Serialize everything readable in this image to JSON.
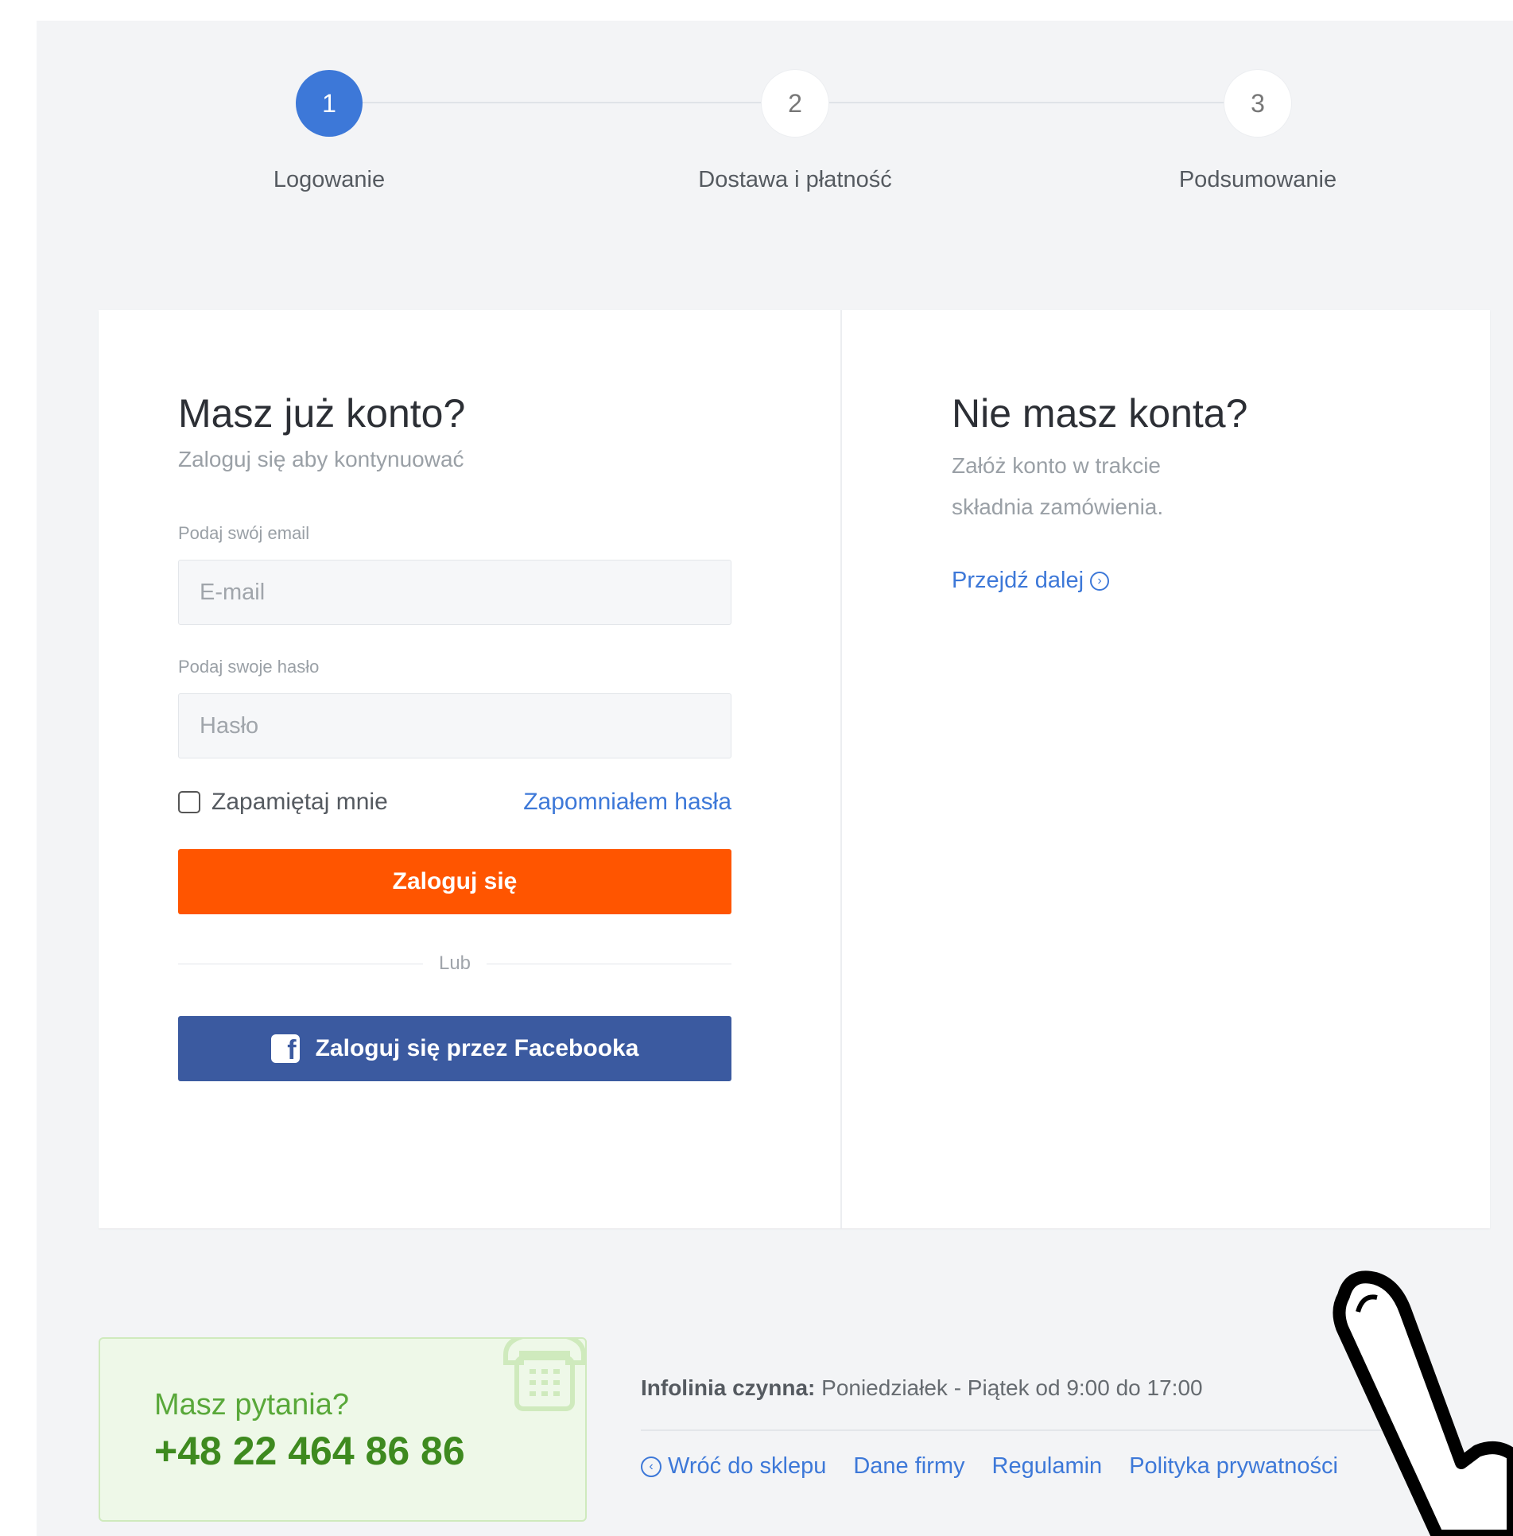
{
  "stepper": {
    "steps": [
      {
        "number": "1",
        "label": "Logowanie",
        "active": true
      },
      {
        "number": "2",
        "label": "Dostawa i płatność",
        "active": false
      },
      {
        "number": "3",
        "label": "Podsumowanie",
        "active": false
      }
    ]
  },
  "login": {
    "title": "Masz już konto?",
    "subtitle": "Zaloguj się aby kontynuować",
    "email_label": "Podaj swój email",
    "email_placeholder": "E-mail",
    "password_label": "Podaj swoje hasło",
    "password_placeholder": "Hasło",
    "remember_label": "Zapamiętaj mnie",
    "forgot_label": "Zapomniałem hasła",
    "login_button": "Zaloguj się",
    "or_label": "Lub",
    "facebook_button": "Zaloguj się przez Facebooka"
  },
  "register": {
    "title": "Nie masz konta?",
    "subtitle": "Załóż konto w trakcie składnia zamówienia.",
    "next_link": "Przejdź dalej"
  },
  "footer": {
    "help_question": "Masz pytania?",
    "help_phone": "+48 22 464 86 86",
    "infoline_label": "Infolinia czynna:",
    "infoline_hours": "Poniedziałek - Piątek od 9:00 do 17:00",
    "links": {
      "back": "Wróć do sklepu",
      "company": "Dane firmy",
      "terms": "Regulamin",
      "privacy": "Polityka prywatności"
    }
  },
  "colors": {
    "accent_blue": "#3d78d8",
    "login_orange": "#ff5500",
    "facebook_blue": "#3b5aa0",
    "help_green": "#3e8a1f"
  },
  "icons": [
    "facebook-icon",
    "arrow-right-circle-icon",
    "arrow-left-circle-icon",
    "phone-icon",
    "hand-cursor-icon"
  ]
}
